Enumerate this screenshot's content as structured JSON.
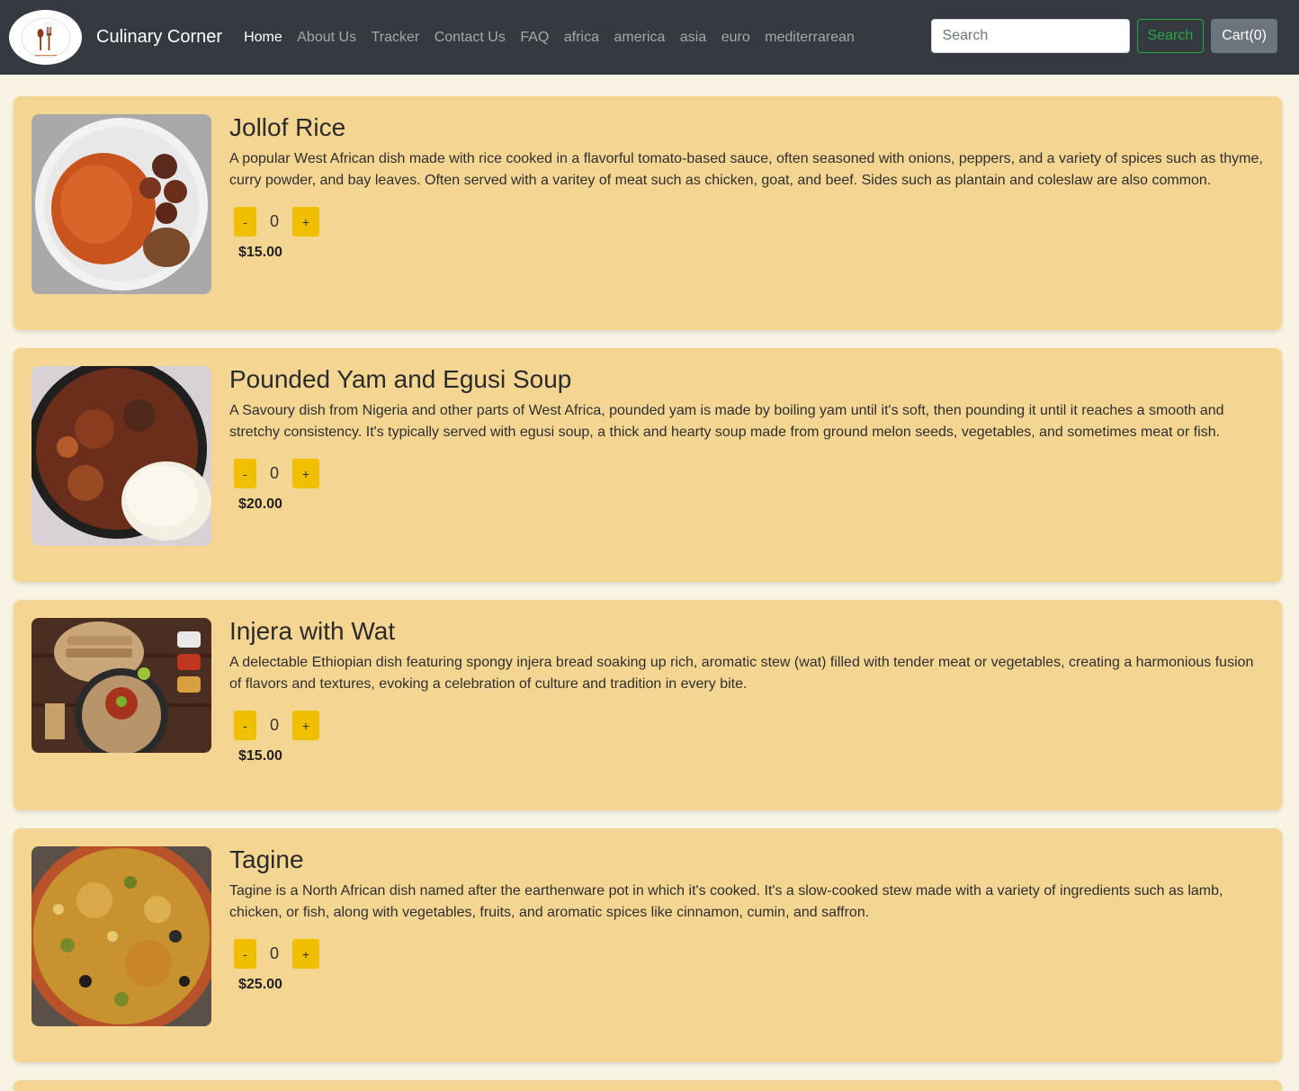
{
  "navbar": {
    "brand": "Culinary Corner",
    "links": [
      "Home",
      "About Us",
      "Tracker",
      "Contact Us",
      "FAQ",
      "africa",
      "america",
      "asia",
      "euro",
      "mediterrarean"
    ],
    "search_placeholder": "Search",
    "search_button": "Search",
    "cart_label": "Cart(0)"
  },
  "colors": {
    "navbar_bg": "#343a40",
    "page_bg": "#f8f3e3",
    "card_bg": "#f5d592",
    "qty_button": "#f0c000",
    "search_green": "#28a745"
  },
  "dishes": [
    {
      "name": "Jollof Rice",
      "description": "A popular West African dish made with rice cooked in a flavorful tomato-based sauce, often seasoned with onions, peppers, and a variety of spices such as thyme, curry powder, and bay leaves. Often served with a varitey of meat such as chicken, goat, and beef. Sides such as plantain and coleslaw are also common.",
      "quantity": "0",
      "price": "$15.00",
      "minus": "-",
      "plus": "+"
    },
    {
      "name": "Pounded Yam and Egusi Soup",
      "description": "A Savoury dish from Nigeria and other parts of West Africa, pounded yam is made by boiling yam until it's soft, then pounding it until it reaches a smooth and stretchy consistency. It's typically served with egusi soup, a thick and hearty soup made from ground melon seeds, vegetables, and sometimes meat or fish.",
      "quantity": "0",
      "price": "$20.00",
      "minus": "-",
      "plus": "+"
    },
    {
      "name": "Injera with Wat",
      "description": "A delectable Ethiopian dish featuring spongy injera bread soaking up rich, aromatic stew (wat) filled with tender meat or vegetables, creating a harmonious fusion of flavors and textures, evoking a celebration of culture and tradition in every bite.",
      "quantity": "0",
      "price": "$15.00",
      "minus": "-",
      "plus": "+"
    },
    {
      "name": "Tagine",
      "description": "Tagine is a North African dish named after the earthenware pot in which it's cooked. It's a slow-cooked stew made with a variety of ingredients such as lamb, chicken, or fish, along with vegetables, fruits, and aromatic spices like cinnamon, cumin, and saffron.",
      "quantity": "0",
      "price": "$25.00",
      "minus": "-",
      "plus": "+"
    }
  ]
}
